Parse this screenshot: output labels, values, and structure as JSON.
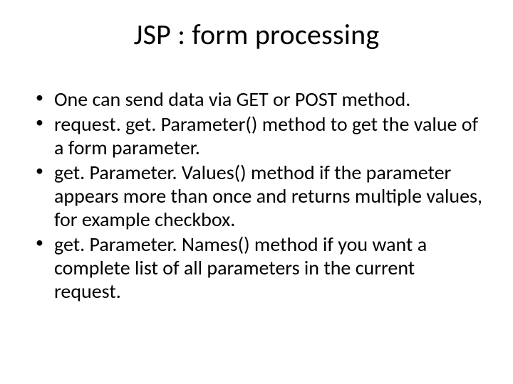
{
  "title": "JSP : form processing",
  "bullets": [
    "One can send data via GET or POST method.",
    "request. get. Parameter() method to get the value of a form parameter.",
    "get. Parameter. Values() method if the parameter appears more than once and returns multiple values, for example checkbox.",
    "get. Parameter. Names() method if you want a complete list of all parameters in the current request."
  ]
}
